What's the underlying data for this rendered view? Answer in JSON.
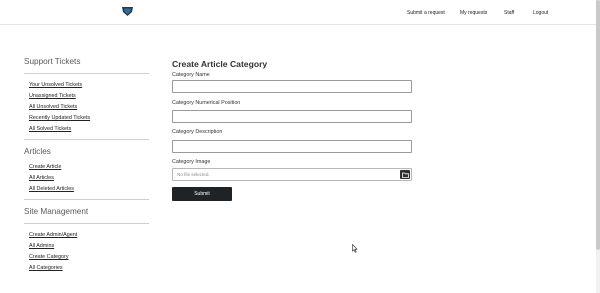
{
  "header": {
    "logo_icon": "shield-emblem-icon",
    "nav": [
      {
        "label": "Submit a request"
      },
      {
        "label": "My requests"
      },
      {
        "label": "Staff"
      },
      {
        "label": "Logout"
      }
    ]
  },
  "sidebar": {
    "sections": [
      {
        "title": "Support Tickets",
        "items": [
          "Your Unsolved Tickets",
          "Unassigned Tickets",
          "All Unsolved Tickets",
          "Recently Updated Tickets",
          "All Solved Tickets"
        ]
      },
      {
        "title": "Articles",
        "items": [
          "Create Article",
          "All Articles",
          "All Deleted Articles"
        ]
      },
      {
        "title": "Site Management",
        "items": [
          "Create Admin/Agent",
          "All Admins",
          "Create Category",
          "All Categories"
        ]
      }
    ]
  },
  "form": {
    "title": "Create Article Category",
    "name_label": "Category Name",
    "name_value": "",
    "position_label": "Category Numerical Position",
    "position_value": "",
    "description_label": "Category Description",
    "description_value": "",
    "image_label": "Category Image",
    "image_placeholder": "No file selected.",
    "browse_icon": "folder-icon",
    "submit_label": "Submit"
  }
}
